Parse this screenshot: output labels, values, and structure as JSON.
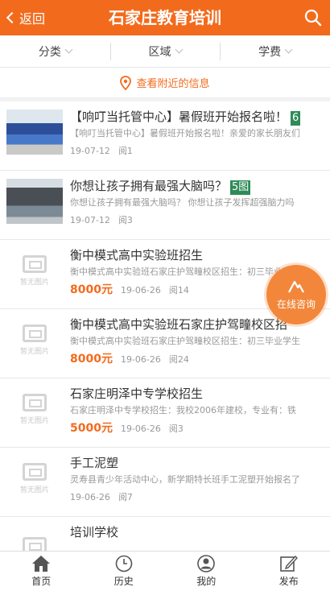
{
  "header": {
    "back_label": "返回",
    "title": "石家庄教育培训"
  },
  "filters": [
    {
      "label": "分类"
    },
    {
      "label": "区域"
    },
    {
      "label": "学费"
    }
  ],
  "nearby_label": "查看附近的信息",
  "items": [
    {
      "title": "【响叮当托管中心】暑假班开始报名啦！",
      "pic_count": "6",
      "desc": "【响叮当托管中心】暑假班开始报名啦！亲爱的家长朋友们",
      "date": "19-07-12",
      "views": "阅1",
      "price": ""
    },
    {
      "title": "你想让孩子拥有最强大脑吗？",
      "pic_count": "5图",
      "desc": "你想让孩子拥有最强大脑吗？ 你想让孩子发挥超强脑力吗",
      "date": "19-07-12",
      "views": "阅3",
      "price": ""
    },
    {
      "title": "衡中模式高中实验班招生",
      "pic_count": "",
      "desc": "衡中模式高中实验班石家庄护驾疃校区招生：初三毕业学生",
      "date": "19-06-26",
      "views": "阅14",
      "price": "8000元"
    },
    {
      "title": "衡中模式高中实验班石家庄护驾疃校区招",
      "pic_count": "",
      "desc": "衡中模式高中实验班石家庄护驾疃校区招生：初三毕业学生",
      "date": "19-06-26",
      "views": "阅24",
      "price": "8000元"
    },
    {
      "title": "石家庄明泽中专学校招生",
      "pic_count": "",
      "desc": "石家庄明泽中专学校招生：我校2006年建校，专业有：铁",
      "date": "19-06-26",
      "views": "阅3",
      "price": "5000元"
    },
    {
      "title": "手工泥塑",
      "pic_count": "",
      "desc": "灵寿县青少年活动中心，新学期特长班手工泥塑开始报名了",
      "date": "19-06-26",
      "views": "阅7",
      "price": ""
    },
    {
      "title": "培训学校",
      "pic_count": "",
      "desc": "",
      "date": "",
      "views": "",
      "price": ""
    }
  ],
  "no_image_label": "暂无图片",
  "consult_label": "在线咨询",
  "tabbar": [
    {
      "label": "首页",
      "icon": "home-icon"
    },
    {
      "label": "历史",
      "icon": "clock-icon"
    },
    {
      "label": "我的",
      "icon": "user-icon"
    },
    {
      "label": "发布",
      "icon": "edit-icon"
    }
  ],
  "colors": {
    "accent": "#f26b1d",
    "badge": "#2e8b57"
  }
}
